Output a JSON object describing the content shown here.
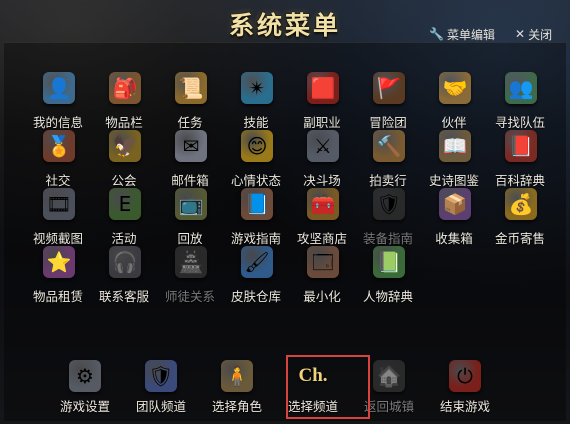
{
  "title": "系统菜单",
  "top_actions": {
    "edit": "菜单编辑",
    "close": "关闭"
  },
  "grid": [
    [
      {
        "label": "我的信息",
        "icon": "avatar-icon",
        "glyph": "👤",
        "bg": "#3d6a8c",
        "disabled": false
      },
      {
        "label": "物品栏",
        "icon": "bag-icon",
        "glyph": "🎒",
        "bg": "#7a5530",
        "disabled": false
      },
      {
        "label": "任务",
        "icon": "scroll-icon",
        "glyph": "📜",
        "bg": "#8a6a2c",
        "disabled": false
      },
      {
        "label": "技能",
        "icon": "skill-orb-icon",
        "glyph": "✴",
        "bg": "#2a6e8f",
        "disabled": false
      },
      {
        "label": "副职业",
        "icon": "red-banner-icon",
        "glyph": "🟥",
        "bg": "#7a1f1a",
        "disabled": false
      },
      {
        "label": "冒险团",
        "icon": "flag-icon",
        "glyph": "🚩",
        "bg": "#5a3a22",
        "disabled": false
      },
      {
        "label": "伙伴",
        "icon": "handshake-icon",
        "glyph": "🤝",
        "bg": "#8a6a38",
        "disabled": false
      },
      {
        "label": "寻找队伍",
        "icon": "party-icon",
        "glyph": "👥",
        "bg": "#3f6a4a",
        "disabled": false
      }
    ],
    [
      {
        "label": "社交",
        "icon": "social-badge-icon",
        "glyph": "🏅",
        "bg": "#6e3a2a",
        "disabled": false
      },
      {
        "label": "公会",
        "icon": "guild-eagle-icon",
        "glyph": "🦅",
        "bg": "#7a6320",
        "disabled": false
      },
      {
        "label": "邮件箱",
        "icon": "mail-icon",
        "glyph": "✉",
        "bg": "#6f7380",
        "disabled": false
      },
      {
        "label": "心情状态",
        "icon": "smile-icon",
        "glyph": "😊",
        "bg": "#9a7a18",
        "disabled": false
      },
      {
        "label": "决斗场",
        "icon": "crossed-swords-icon",
        "glyph": "⚔",
        "bg": "#555b66",
        "disabled": false
      },
      {
        "label": "拍卖行",
        "icon": "gavel-icon",
        "glyph": "🔨",
        "bg": "#7a5a30",
        "disabled": false
      },
      {
        "label": "史诗图鉴",
        "icon": "book-icon",
        "glyph": "📖",
        "bg": "#6d5a3a",
        "disabled": false
      },
      {
        "label": "百科辞典",
        "icon": "encyclopedia-icon",
        "glyph": "📕",
        "bg": "#7a2a22",
        "disabled": false
      }
    ],
    [
      {
        "label": "视频截图",
        "icon": "camera-icon",
        "glyph": "🎞",
        "bg": "#4a4f5a",
        "disabled": false
      },
      {
        "label": "活动",
        "icon": "event-board-icon",
        "glyph": "E",
        "bg": "#3a5a2e",
        "disabled": false
      },
      {
        "label": "回放",
        "icon": "replay-tv-icon",
        "glyph": "📺",
        "bg": "#555a33",
        "disabled": false
      },
      {
        "label": "游戏指南",
        "icon": "guide-book-icon",
        "glyph": "📘",
        "bg": "#6e4a38",
        "disabled": false
      },
      {
        "label": "攻坚商店",
        "icon": "treasure-chest-icon",
        "glyph": "🧰",
        "bg": "#7a5a22",
        "disabled": false
      },
      {
        "label": "装备指南",
        "icon": "armor-guide-icon",
        "glyph": "🛡",
        "bg": "#4a4a4a",
        "disabled": true
      },
      {
        "label": "收集箱",
        "icon": "collection-box-icon",
        "glyph": "📦",
        "bg": "#5a3f70",
        "disabled": false
      },
      {
        "label": "金币寄售",
        "icon": "gold-coin-icon",
        "glyph": "💰",
        "bg": "#8a6a1e",
        "disabled": false
      }
    ],
    [
      {
        "label": "物品租赁",
        "icon": "rental-star-icon",
        "glyph": "⭐",
        "bg": "#6a3a6e",
        "disabled": false
      },
      {
        "label": "联系客服",
        "icon": "headset-icon",
        "glyph": "🎧",
        "bg": "#3a3a40",
        "disabled": false
      },
      {
        "label": "师徒关系",
        "icon": "mentor-icon",
        "glyph": "🏯",
        "bg": "#4a4a4a",
        "disabled": true
      },
      {
        "label": "皮肤仓库",
        "icon": "brush-icon",
        "glyph": "🖌",
        "bg": "#2f5a8a",
        "disabled": false
      },
      {
        "label": "最小化",
        "icon": "minimize-icon",
        "glyph": "🗔",
        "bg": "#6a4a3a",
        "disabled": false
      },
      {
        "label": "人物辞典",
        "icon": "character-dictionary-icon",
        "glyph": "📗",
        "bg": "#3a6a3a",
        "disabled": false
      }
    ]
  ],
  "bottom": [
    {
      "label": "游戏设置",
      "icon": "gear-icon",
      "glyph": "⚙",
      "bg": "#555a63",
      "disabled": false
    },
    {
      "label": "团队频道",
      "icon": "team-shield-icon",
      "glyph": "🛡",
      "bg": "#3a4a7a",
      "disabled": false
    },
    {
      "label": "选择角色",
      "icon": "character-icon",
      "glyph": "🧍",
      "bg": "#6a5a3a",
      "disabled": false
    },
    {
      "label": "选择频道",
      "icon": "channel-icon",
      "glyph": "Ch.",
      "bg": "transparent",
      "disabled": false
    },
    {
      "label": "返回城镇",
      "icon": "home-icon",
      "glyph": "🏠",
      "bg": "#4a4a4a",
      "disabled": true
    },
    {
      "label": "结束游戏",
      "icon": "power-icon",
      "glyph": "⏻",
      "bg": "#7a1f1a",
      "disabled": false
    }
  ]
}
